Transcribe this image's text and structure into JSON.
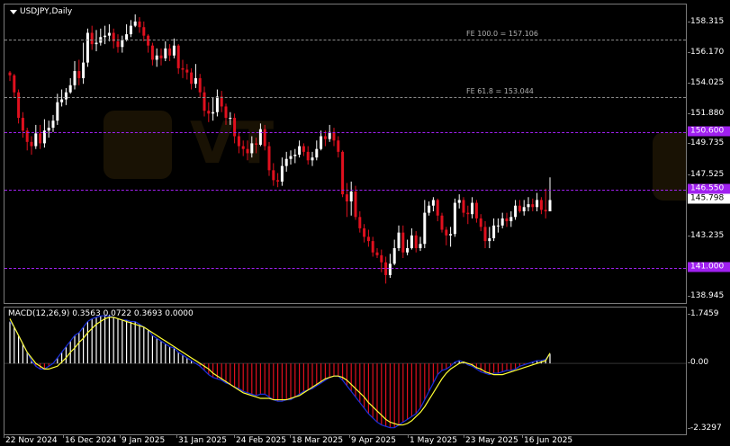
{
  "symbol": {
    "title": "USDJPY,Daily"
  },
  "watermark": {
    "brand": "VT"
  },
  "colors": {
    "bull": "#ffffff",
    "bear": "#e0101e",
    "level": "#a020f0",
    "fib": "#8a8a8a",
    "macd_main": "#1a2fdc",
    "macd_signal": "#ffff33",
    "hist_pos": "#ffffff",
    "hist_neg": "#e0101e"
  },
  "price_axis": {
    "ticks": [
      "158.315",
      "156.170",
      "154.025",
      "151.880",
      "149.735",
      "147.525",
      "143.235",
      "138.945"
    ]
  },
  "levels": [
    {
      "label": "150.600",
      "value": 150.6
    },
    {
      "label": "146.550",
      "value": 146.55
    },
    {
      "label": "141.000",
      "value": 141.0
    }
  ],
  "fib_levels": [
    {
      "label": "FE 100.0 = 157.106",
      "value": 157.106
    },
    {
      "label": "FE 61.8 = 153.044",
      "value": 153.044
    }
  ],
  "current_price": {
    "label": "145.798",
    "value": 145.798
  },
  "macd": {
    "title": "MACD(12,26,9) 0.3563 0.0722 0.3693 0.0000",
    "axis_ticks": [
      "1.7459",
      "0.00",
      "-2.3297"
    ]
  },
  "date_axis": {
    "labels": [
      "22 Nov 2024",
      "16 Dec 2024",
      "9 Jan 2025",
      "31 Jan 2025",
      "24 Feb 2025",
      "18 Mar 2025",
      "9 Apr 2025",
      "1 May 2025",
      "23 May 2025",
      "16 Jun 2025"
    ]
  },
  "chart_data": {
    "type": "candlestick",
    "title": "USDJPY,Daily",
    "price_range": [
      138.4,
      159.6
    ],
    "macd_range": [
      -2.6,
      2.0
    ],
    "closes": [
      154.6,
      153.4,
      151.6,
      150.7,
      149.9,
      149.6,
      150.5,
      149.8,
      150.7,
      150.9,
      151.4,
      152.7,
      152.9,
      153.4,
      153.9,
      154.9,
      154.4,
      155.5,
      157.6,
      156.8,
      156.9,
      157.3,
      157.4,
      157.6,
      157.0,
      156.6,
      157.1,
      157.5,
      158.1,
      158.4,
      158.0,
      157.4,
      156.7,
      155.7,
      156.0,
      155.8,
      156.5,
      156.0,
      156.7,
      155.1,
      155.0,
      154.8,
      154.0,
      154.4,
      153.4,
      152.1,
      151.9,
      152.0,
      153.1,
      152.4,
      151.6,
      151.6,
      150.3,
      149.6,
      149.4,
      149.1,
      149.8,
      149.7,
      150.8,
      149.6,
      147.9,
      147.2,
      147.1,
      148.2,
      148.7,
      148.9,
      149.0,
      149.6,
      149.2,
      148.6,
      148.8,
      149.4,
      150.3,
      150.1,
      150.6,
      150.0,
      149.2,
      146.2,
      145.7,
      146.4,
      144.6,
      143.8,
      143.2,
      142.9,
      142.1,
      141.9,
      141.4,
      140.5,
      141.3,
      142.4,
      143.5,
      142.1,
      142.4,
      143.3,
      142.4,
      142.7,
      144.9,
      145.4,
      145.8,
      144.7,
      143.7,
      143.3,
      143.4,
      145.6,
      145.8,
      144.9,
      144.8,
      145.6,
      144.5,
      143.9,
      142.9,
      143.1,
      144.0,
      144.0,
      144.5,
      144.3,
      144.6,
      145.4,
      145.0,
      145.3,
      145.5,
      145.3,
      145.8,
      145.1,
      145.0,
      145.8
    ],
    "highs": [
      154.9,
      154.7,
      153.6,
      152.0,
      150.9,
      150.3,
      151.1,
      151.1,
      151.5,
      151.4,
      151.8,
      153.3,
      153.6,
      153.7,
      154.4,
      155.6,
      155.7,
      156.9,
      157.9,
      158.1,
      157.8,
      157.9,
      158.1,
      158.2,
      157.9,
      157.5,
      157.4,
      158.2,
      158.5,
      158.9,
      158.7,
      158.4,
      157.5,
      156.9,
      156.5,
      156.5,
      157.0,
      156.8,
      157.2,
      156.8,
      155.7,
      155.4,
      155.1,
      155.4,
      154.7,
      153.8,
      152.7,
      153.0,
      153.6,
      153.5,
      152.6,
      152.0,
      151.9,
      150.6,
      150.0,
      150.0,
      150.3,
      150.2,
      151.2,
      151.1,
      149.9,
      148.4,
      147.7,
      148.8,
      149.2,
      149.3,
      149.4,
      150.0,
      149.8,
      149.6,
      149.2,
      150.0,
      150.7,
      150.7,
      151.1,
      150.9,
      150.3,
      149.3,
      147.0,
      147.1,
      146.8,
      145.0,
      144.1,
      143.7,
      143.2,
      142.4,
      142.3,
      141.8,
      142.0,
      143.0,
      144.0,
      144.0,
      143.0,
      143.8,
      143.6,
      143.2,
      145.8,
      145.7,
      146.0,
      145.9,
      144.9,
      143.9,
      143.9,
      145.9,
      146.2,
      146.0,
      145.4,
      146.0,
      145.8,
      144.8,
      144.3,
      143.9,
      144.5,
      144.5,
      144.9,
      144.9,
      145.0,
      145.8,
      145.8,
      145.8,
      146.0,
      145.9,
      146.3,
      146.0,
      146.6,
      147.4
    ],
    "lows": [
      154.2,
      153.0,
      151.2,
      150.2,
      149.3,
      149.0,
      149.4,
      149.4,
      149.5,
      150.2,
      150.6,
      151.1,
      152.4,
      152.5,
      153.3,
      153.6,
      153.9,
      154.0,
      155.2,
      156.4,
      156.3,
      156.7,
      156.8,
      157.0,
      156.5,
      156.2,
      156.2,
      157.0,
      157.3,
      158.0,
      157.6,
      157.0,
      156.2,
      155.3,
      155.2,
      155.3,
      155.6,
      155.6,
      155.8,
      154.7,
      154.4,
      154.3,
      153.6,
      153.7,
      153.0,
      151.7,
      151.3,
      151.4,
      151.7,
      152.0,
      151.1,
      151.1,
      149.8,
      149.1,
      148.9,
      148.6,
      148.8,
      149.1,
      149.6,
      149.3,
      147.5,
      146.8,
      146.7,
      146.8,
      147.8,
      148.3,
      148.4,
      148.8,
      148.9,
      148.3,
      148.2,
      148.6,
      149.3,
      149.6,
      149.9,
      149.6,
      148.8,
      146.0,
      144.6,
      144.7,
      144.4,
      143.5,
      142.8,
      142.5,
      141.8,
      141.7,
      140.7,
      139.9,
      140.3,
      141.2,
      142.2,
      141.7,
      141.9,
      142.3,
      142.1,
      142.2,
      142.4,
      144.7,
      145.0,
      144.3,
      143.5,
      142.6,
      142.5,
      143.2,
      145.2,
      144.6,
      144.1,
      144.5,
      144.2,
      143.6,
      142.4,
      142.4,
      142.9,
      143.5,
      143.8,
      143.9,
      143.9,
      144.4,
      144.9,
      144.7,
      145.0,
      145.0,
      145.0,
      144.8,
      144.5,
      145.0
    ],
    "macd_main": [
      1.5,
      1.3,
      1.0,
      0.7,
      0.4,
      0.1,
      -0.1,
      -0.2,
      -0.2,
      -0.1,
      0.0,
      0.2,
      0.4,
      0.6,
      0.8,
      1.0,
      1.1,
      1.3,
      1.5,
      1.6,
      1.65,
      1.7,
      1.7,
      1.7,
      1.65,
      1.6,
      1.55,
      1.55,
      1.5,
      1.5,
      1.4,
      1.3,
      1.2,
      1.0,
      0.9,
      0.8,
      0.7,
      0.6,
      0.55,
      0.4,
      0.3,
      0.2,
      0.1,
      0.0,
      -0.1,
      -0.25,
      -0.4,
      -0.5,
      -0.55,
      -0.6,
      -0.7,
      -0.75,
      -0.85,
      -0.9,
      -1.0,
      -1.05,
      -1.1,
      -1.15,
      -1.1,
      -1.1,
      -1.2,
      -1.3,
      -1.35,
      -1.35,
      -1.3,
      -1.3,
      -1.2,
      -1.1,
      -1.0,
      -0.95,
      -0.9,
      -0.8,
      -0.7,
      -0.6,
      -0.5,
      -0.45,
      -0.45,
      -0.6,
      -0.8,
      -1.0,
      -1.2,
      -1.4,
      -1.6,
      -1.8,
      -1.95,
      -2.1,
      -2.2,
      -2.25,
      -2.3,
      -2.3,
      -2.2,
      -2.1,
      -2.0,
      -1.9,
      -1.8,
      -1.6,
      -1.3,
      -1.0,
      -0.7,
      -0.4,
      -0.25,
      -0.2,
      -0.1,
      0.05,
      0.1,
      0.05,
      -0.05,
      -0.1,
      -0.2,
      -0.3,
      -0.35,
      -0.4,
      -0.35,
      -0.35,
      -0.3,
      -0.25,
      -0.25,
      -0.2,
      -0.1,
      -0.05,
      0.0,
      0.05,
      0.1,
      0.1,
      0.15,
      0.35
    ],
    "macd_signal": [
      1.6,
      1.3,
      1.0,
      0.7,
      0.4,
      0.2,
      0.0,
      -0.1,
      -0.2,
      -0.2,
      -0.15,
      -0.1,
      0.05,
      0.2,
      0.4,
      0.55,
      0.75,
      0.9,
      1.1,
      1.25,
      1.4,
      1.5,
      1.6,
      1.65,
      1.65,
      1.6,
      1.55,
      1.5,
      1.45,
      1.4,
      1.35,
      1.3,
      1.2,
      1.1,
      1.0,
      0.9,
      0.8,
      0.7,
      0.6,
      0.5,
      0.4,
      0.3,
      0.2,
      0.1,
      0.0,
      -0.1,
      -0.2,
      -0.35,
      -0.45,
      -0.55,
      -0.65,
      -0.75,
      -0.85,
      -0.95,
      -1.05,
      -1.1,
      -1.15,
      -1.2,
      -1.25,
      -1.25,
      -1.25,
      -1.3,
      -1.3,
      -1.3,
      -1.3,
      -1.25,
      -1.2,
      -1.15,
      -1.05,
      -0.95,
      -0.85,
      -0.75,
      -0.65,
      -0.55,
      -0.5,
      -0.45,
      -0.45,
      -0.5,
      -0.6,
      -0.75,
      -0.9,
      -1.05,
      -1.2,
      -1.4,
      -1.55,
      -1.7,
      -1.85,
      -2.0,
      -2.1,
      -2.15,
      -2.2,
      -2.2,
      -2.15,
      -2.05,
      -1.9,
      -1.75,
      -1.55,
      -1.3,
      -1.05,
      -0.8,
      -0.55,
      -0.35,
      -0.2,
      -0.1,
      0.0,
      0.05,
      0.0,
      -0.05,
      -0.15,
      -0.2,
      -0.3,
      -0.35,
      -0.4,
      -0.4,
      -0.4,
      -0.35,
      -0.3,
      -0.25,
      -0.2,
      -0.15,
      -0.1,
      -0.05,
      0.0,
      0.05,
      0.1,
      0.37
    ]
  }
}
